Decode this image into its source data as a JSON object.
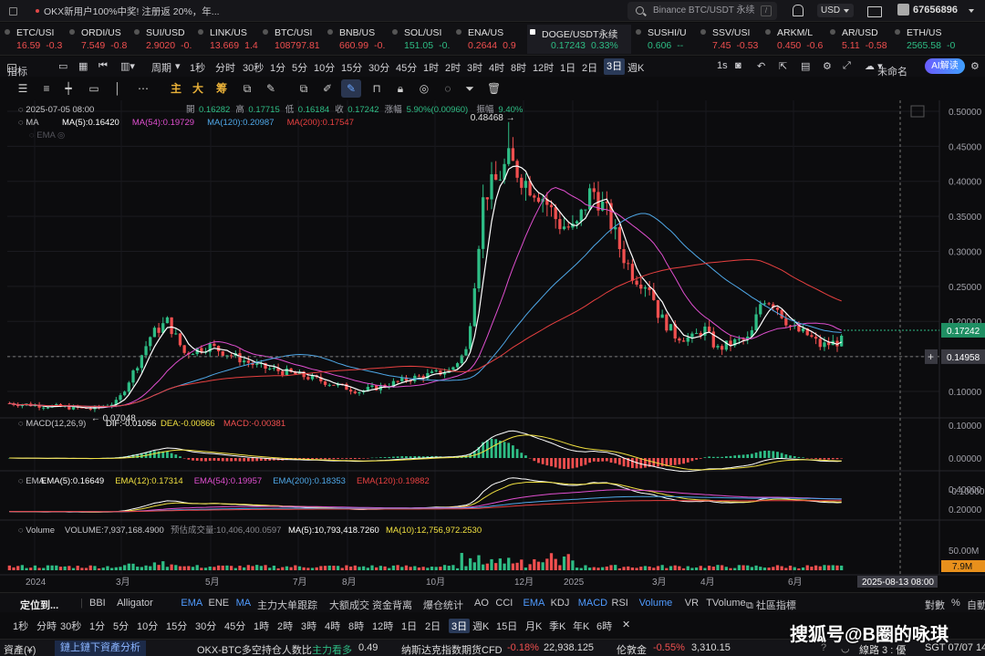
{
  "topbar": {
    "promo": "OKX新用户100%中奖! 注册返 20%，年...",
    "search_placeholder": "Binance BTC/USDT 永续",
    "search_shortcut": "/",
    "currency": "USD",
    "user_id": "67656896"
  },
  "tickers": [
    {
      "symbol": "ETC/USI",
      "price": "16.59",
      "change": "-0.3",
      "dir": "down"
    },
    {
      "symbol": "ORDI/US",
      "price": "7.549",
      "change": "-0.8",
      "dir": "down"
    },
    {
      "symbol": "SUI/USD",
      "price": "2.9020",
      "change": "-0.",
      "dir": "down"
    },
    {
      "symbol": "LINK/US",
      "price": "13.669",
      "change": "1.4",
      "dir": "down"
    },
    {
      "symbol": "BTC/USI",
      "price": "108797.81",
      "change": "",
      "dir": "down"
    },
    {
      "symbol": "BNB/US",
      "price": "660.99",
      "change": "-0.",
      "dir": "down"
    },
    {
      "symbol": "SOL/USI",
      "price": "151.05",
      "change": "-0.",
      "dir": "up"
    },
    {
      "symbol": "ENA/US",
      "price": "0.2644",
      "change": "0.9",
      "dir": "down"
    },
    {
      "symbol": "DOGE/USDT永续",
      "price": "0.17243",
      "change": "0.33%",
      "dir": "up",
      "active": true
    },
    {
      "symbol": "SUSHI/U",
      "price": "0.606",
      "change": "--",
      "dir": "up"
    },
    {
      "symbol": "SSV/USI",
      "price": "7.45",
      "change": "-0.53",
      "dir": "down"
    },
    {
      "symbol": "ARKM/L",
      "price": "0.450",
      "change": "-0.6",
      "dir": "down"
    },
    {
      "symbol": "AR/USD",
      "price": "5.11",
      "change": "-0.58",
      "dir": "down"
    },
    {
      "symbol": "ETH/US",
      "price": "2565.58",
      "change": "-0",
      "dir": "up"
    }
  ],
  "toolbar": {
    "indicator": "指标",
    "period": "周期",
    "timeframes": [
      "1秒",
      "分时",
      "30秒",
      "1分",
      "5分",
      "10分",
      "15分",
      "30分",
      "45分",
      "1时",
      "2时",
      "3时",
      "4时",
      "8时",
      "12时",
      "1日",
      "2日",
      "3日",
      "週K"
    ],
    "selected_timeframe": "3日",
    "right_tf": "1s",
    "unnamed": "未命名",
    "ai": "AI解读"
  },
  "drawing": {
    "zhu": "主",
    "da": "大",
    "chou": "筹"
  },
  "ohlc": {
    "date": "2025-07-05 08:00",
    "open_label": "開",
    "open": "0.16282",
    "high_label": "高",
    "high": "0.17715",
    "low_label": "低",
    "low": "0.16184",
    "close_label": "收",
    "close": "0.17242",
    "chg_label": "涨幅",
    "chg": "5.90%(0.00960)",
    "amp_label": "振幅",
    "amp": "9.40%"
  },
  "ma_legend": {
    "name": "MA",
    "items": [
      {
        "label": "MA(5):0.16420",
        "color": "#ffffff"
      },
      {
        "label": "MA(54):0.19729",
        "color": "#e04fd0"
      },
      {
        "label": "MA(120):0.20987",
        "color": "#4fa8e8"
      },
      {
        "label": "MA(200):0.17547",
        "color": "#e84040"
      }
    ]
  },
  "ema_ghost": "EMA",
  "price_axis": [
    "0.50000",
    "0.45000",
    "0.40000",
    "0.35000",
    "0.30000",
    "0.25000",
    "0.20000",
    "0.15000",
    "0.10000"
  ],
  "price_tags": {
    "last": "0.17242",
    "cross": "0.14958"
  },
  "annotations": {
    "high": "0.48468",
    "low": "0.07048"
  },
  "macd": {
    "title": "MACD(12,26,9)",
    "dif": "DIF:-0.01056",
    "dea": "DEA:-0.00866",
    "macd": "MACD:-0.00381",
    "axis": [
      "0.10000",
      "0.00000",
      "-0.10000"
    ]
  },
  "ema_panel": {
    "title": "EMA",
    "items": [
      {
        "label": "EMA(5):0.16649",
        "color": "#ffffff"
      },
      {
        "label": "EMA(12):0.17314",
        "color": "#f0e040"
      },
      {
        "label": "EMA(54):0.19957",
        "color": "#e04fd0"
      },
      {
        "label": "EMA(200):0.18353",
        "color": "#4fa8e8"
      },
      {
        "label": "EMA(120):0.19882",
        "color": "#e84040"
      }
    ],
    "axis": [
      "0.40000",
      "0.20000"
    ]
  },
  "volume": {
    "title": "Volume",
    "vol": "VOLUME:7,937,168.4900",
    "est": "预估成交量:10,406,400.0597",
    "ma5": "MA(5):10,793,418.7260",
    "ma10": "MA(10):12,756,972.2530",
    "axis": "50.00M",
    "tag": "7.9M"
  },
  "time_axis": [
    "2024",
    "3月",
    "5月",
    "7月",
    "8月",
    "10月",
    "12月",
    "2025",
    "3月",
    "4月",
    "6月"
  ],
  "crosshair_time": "2025-08-13 08:00",
  "indicator_row": {
    "locate": "定位到...",
    "main": [
      "BBI",
      "Alligator",
      "EMA",
      "ENE",
      "MA",
      "主力大单跟踪",
      "大额成交"
    ],
    "sub": [
      "资金背离",
      "爆仓统计",
      "AO",
      "CCI",
      "EMA",
      "KDJ",
      "MACD",
      "RSI",
      "Volume",
      "VR",
      "TVolume"
    ],
    "community": "社區指標",
    "right": [
      "對數",
      "%",
      "自動"
    ]
  },
  "tf_row": [
    "1秒",
    "分時",
    "30秒",
    "1分",
    "5分",
    "10分",
    "15分",
    "30分",
    "45分",
    "1時",
    "2時",
    "3時",
    "4時",
    "8時",
    "12時",
    "1日",
    "2日",
    "3日",
    "週K",
    "15日",
    "月K",
    "季K",
    "年K",
    "6時"
  ],
  "tf_selected": "3日",
  "status": {
    "assets": "資產(¥)",
    "chain": "鏈上鏈下資產分析",
    "news1": "OKX-BTC多空持仓人数比",
    "news1b": "主力看多",
    "news1v": "0.49",
    "news2": "纳斯达克指数期货CFD",
    "news2c": "-0.18%",
    "news2v": "22,938.125",
    "news3": "伦敦金",
    "news3c": "-0.55%",
    "news3v": "3,310.15",
    "line": "線路 3 : 優",
    "tz": "SGT 07/07 14"
  },
  "watermark": "搜狐号@B圈的咏琪",
  "chart_data": {
    "type": "candlestick",
    "title": "DOGE/USDT永续 3日",
    "x": [
      "2024-01",
      "2024-03",
      "2024-05",
      "2024-07",
      "2024-08",
      "2024-10",
      "2024-12",
      "2025-01",
      "2025-03",
      "2025-04",
      "2025-06",
      "2025-07"
    ],
    "close": [
      0.085,
      0.17,
      0.16,
      0.125,
      0.11,
      0.12,
      0.4,
      0.33,
      0.2,
      0.165,
      0.18,
      0.172
    ],
    "high": 0.48468,
    "low": 0.07048,
    "ylim": [
      0.08,
      0.5
    ]
  }
}
